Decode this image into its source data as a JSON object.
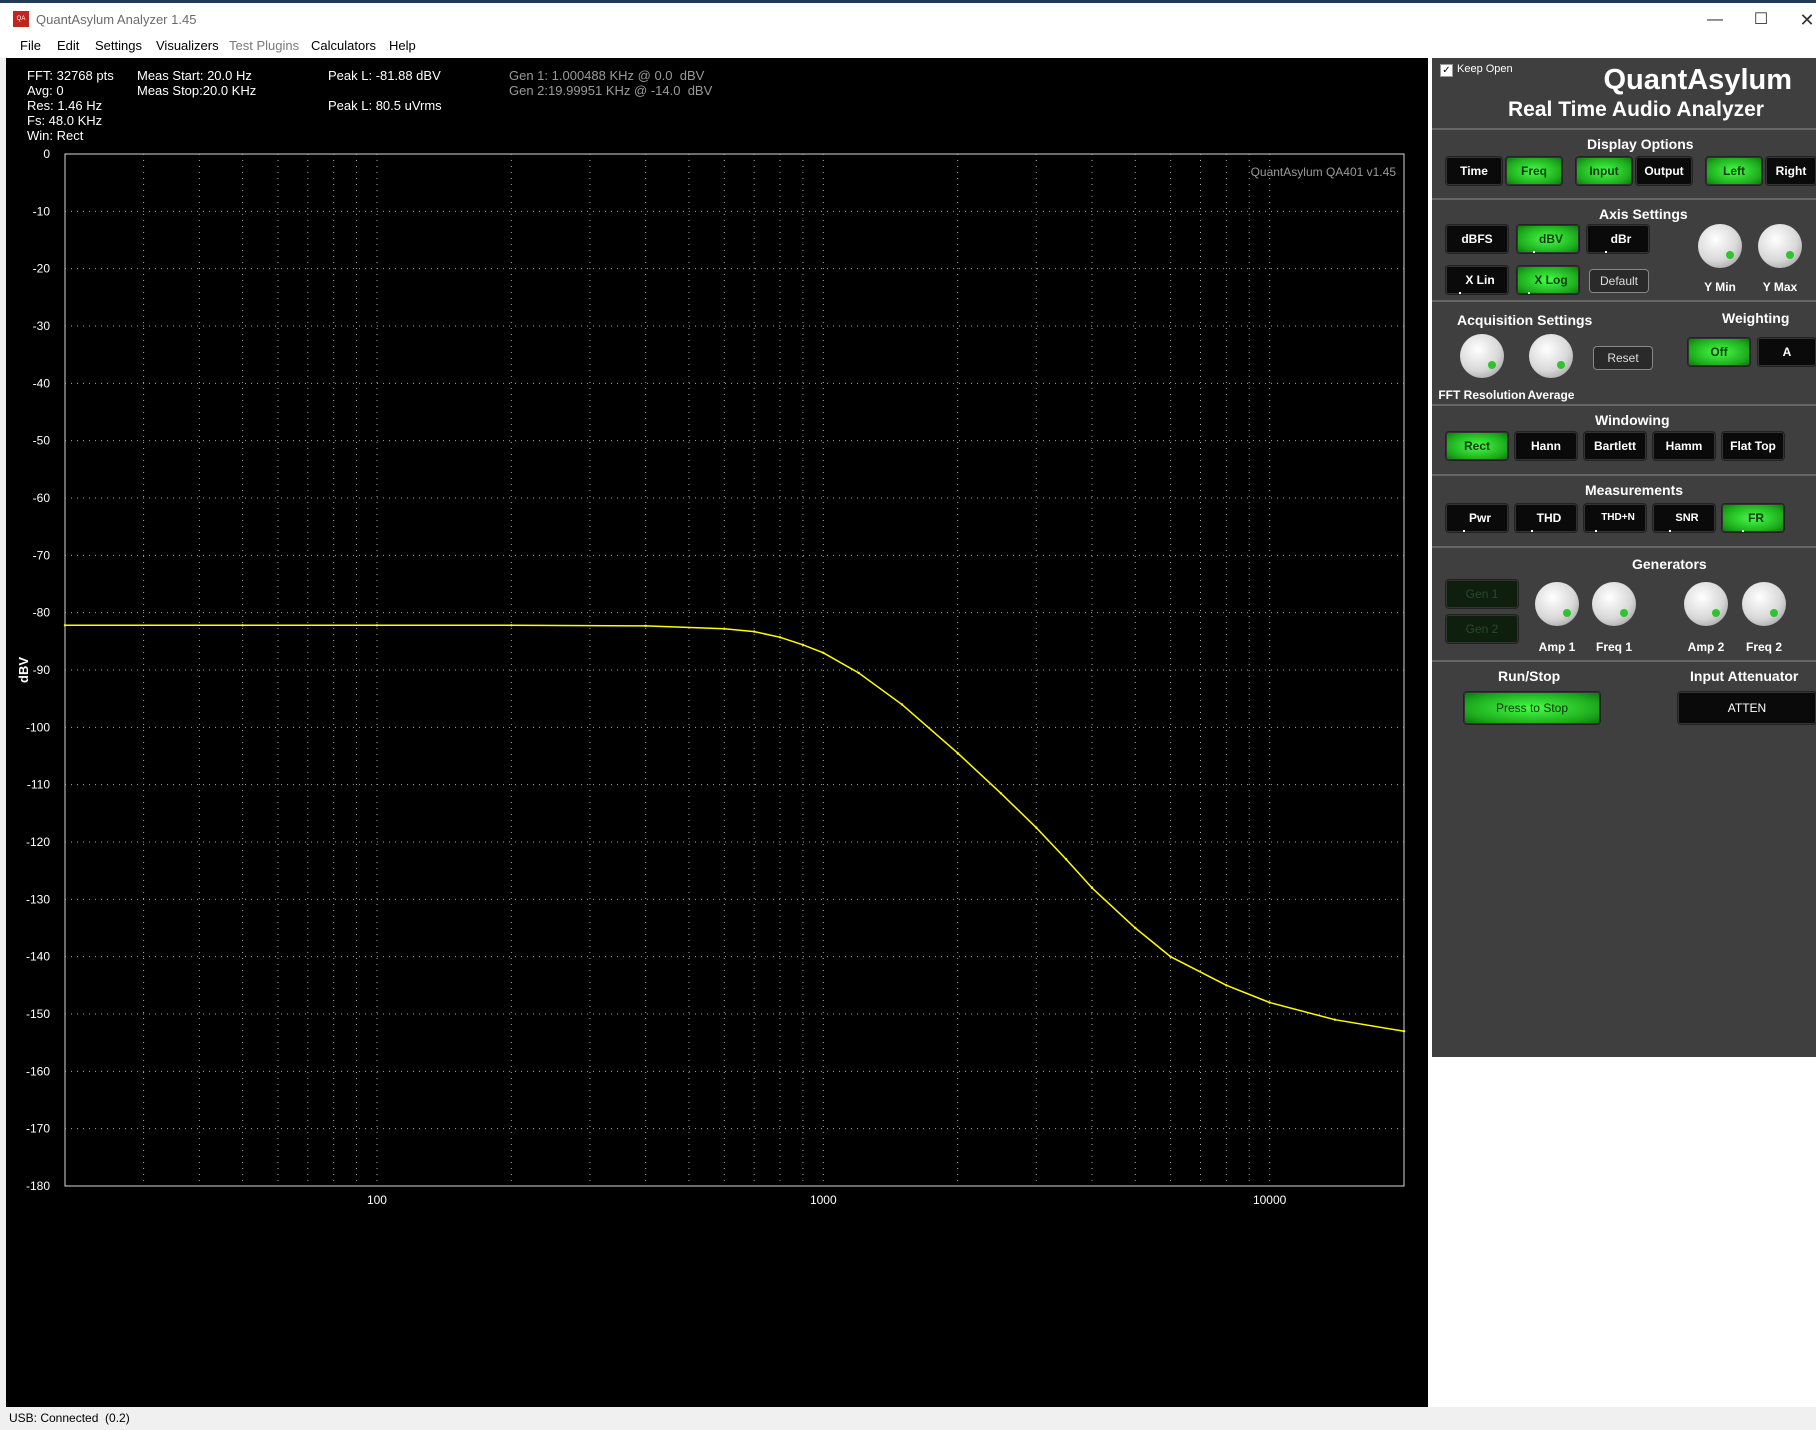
{
  "window": {
    "title": "QuantAsylum Analyzer 1.45",
    "icon_label": "QA"
  },
  "menu": [
    "File",
    "Edit",
    "Settings",
    "Visualizers",
    "Test Plugins",
    "Calculators",
    "Help"
  ],
  "stats": {
    "fft": "FFT: 32768 pts",
    "avg": "Avg: 0",
    "res": "Res: 1.46 Hz",
    "fs": "Fs: 48.0 KHz",
    "win": "Win: Rect",
    "meas_start": "Meas Start: 20.0 Hz",
    "meas_stop": "Meas Stop:20.0 KHz",
    "peak_dbv": "Peak L: -81.88 dBV",
    "peak_vrms": "Peak L: 80.5 uVrms",
    "gen1": "Gen 1: 1.000488 KHz @ 0.0  dBV",
    "gen2": "Gen 2:19.99951 KHz @ -14.0  dBV"
  },
  "chart_data": {
    "type": "line",
    "watermark": "QuantAsylum QA401 v1.45",
    "ylabel": "dBV",
    "xlabel": "",
    "xscale": "log",
    "xlim": [
      20,
      20000
    ],
    "ylim": [
      -180,
      0
    ],
    "yticks": [
      0,
      -10,
      -20,
      -30,
      -40,
      -50,
      -60,
      -70,
      -80,
      -90,
      -100,
      -110,
      -120,
      -130,
      -140,
      -150,
      -160,
      -170,
      -180
    ],
    "xticks": [
      100,
      1000,
      10000
    ],
    "grid": true,
    "series": [
      {
        "color": "#ffff00",
        "x": [
          20,
          50,
          100,
          200,
          400,
          600,
          700,
          800,
          900,
          1000,
          1200,
          1500,
          2000,
          2500,
          3000,
          3500,
          4000,
          5000,
          6000,
          8000,
          10000,
          14000,
          20000
        ],
        "values": [
          -82.2,
          -82.2,
          -82.2,
          -82.2,
          -82.3,
          -82.8,
          -83.3,
          -84.3,
          -85.6,
          -87.0,
          -90.5,
          -96.0,
          -104.5,
          -111.5,
          -117.5,
          -123.0,
          -128.0,
          -135.0,
          -140.0,
          -145.0,
          -148.0,
          -151.0,
          -153.0
        ]
      }
    ]
  },
  "panel": {
    "keep_open": "Keep Open",
    "brand": "QuantAsylum",
    "subtitle": "Real Time Audio Analyzer",
    "display_options": {
      "title": "Display Options",
      "buttons": [
        {
          "label": "Time",
          "on": false
        },
        {
          "label": "Freq",
          "on": true
        },
        {
          "label": "Input",
          "on": true
        },
        {
          "label": "Output",
          "on": false
        },
        {
          "label": "Left",
          "on": true
        },
        {
          "label": "Right",
          "on": false
        }
      ]
    },
    "axis_settings": {
      "title": "Axis Settings",
      "dbfs": "dBFS",
      "dbv": "dBV",
      "dbr": "dBr",
      "xlin": "X Lin",
      "xlog": "X Log",
      "default": "Default",
      "ymin": "Y Min",
      "ymax": "Y Max"
    },
    "acquisition": {
      "title": "Acquisition Settings",
      "fft_res": "FFT Resolution",
      "average": "Average",
      "reset": "Reset"
    },
    "weighting": {
      "title": "Weighting",
      "off": "Off",
      "a": "A"
    },
    "windowing": {
      "title": "Windowing",
      "buttons": [
        {
          "label": "Rect",
          "on": true
        },
        {
          "label": "Hann",
          "on": false
        },
        {
          "label": "Bartlett",
          "on": false
        },
        {
          "label": "Hamm",
          "on": false
        },
        {
          "label": "Flat Top",
          "on": false
        }
      ]
    },
    "measurements": {
      "title": "Measurements",
      "buttons": [
        {
          "label": "Pwr",
          "on": false
        },
        {
          "label": "THD",
          "on": false
        },
        {
          "label": "THD+N",
          "on": false
        },
        {
          "label": "SNR",
          "on": false
        },
        {
          "label": "FR",
          "on": true
        }
      ]
    },
    "generators": {
      "title": "Generators",
      "gen1": "Gen 1",
      "gen2": "Gen 2",
      "amp1": "Amp 1",
      "freq1": "Freq 1",
      "amp2": "Amp 2",
      "freq2": "Freq 2"
    },
    "run_stop": {
      "title": "Run/Stop",
      "button": "Press to Stop"
    },
    "input_attenuator": {
      "title": "Input Attenuator",
      "button": "ATTEN"
    }
  },
  "status": "USB: Connected  (0.2)",
  "colors": {
    "trace": "#ffff00",
    "led_on": "#2ec42e",
    "panel_bg": "#3f3f3f",
    "plot_bg": "#000000"
  }
}
